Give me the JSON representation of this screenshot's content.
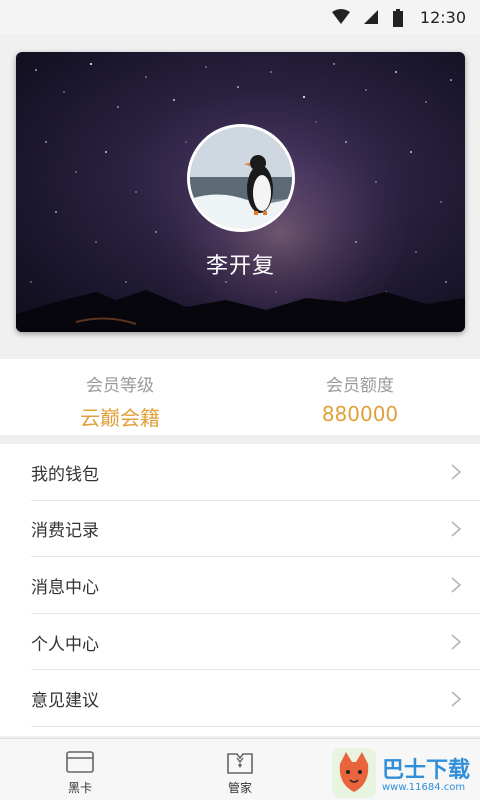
{
  "status_bar": {
    "time": "12:30",
    "icons": [
      "wifi-icon",
      "cell-signal-icon",
      "battery-icon"
    ]
  },
  "profile": {
    "name": "李开复",
    "avatar": "penguin-avatar"
  },
  "membership": {
    "level_label": "会员等级",
    "level_value": "云巅会籍",
    "quota_label": "会员额度",
    "quota_value": "880000",
    "accent_color": "#e0a03a"
  },
  "menu": {
    "items": [
      {
        "label": "我的钱包"
      },
      {
        "label": "消费记录"
      },
      {
        "label": "消息中心"
      },
      {
        "label": "个人中心"
      },
      {
        "label": "意见建议"
      }
    ]
  },
  "tabs": [
    {
      "label": "黑卡",
      "icon": "card-icon"
    },
    {
      "label": "管家",
      "icon": "butler-icon"
    }
  ],
  "watermark": {
    "text": "巴士下载",
    "url": "www.11684.com"
  }
}
